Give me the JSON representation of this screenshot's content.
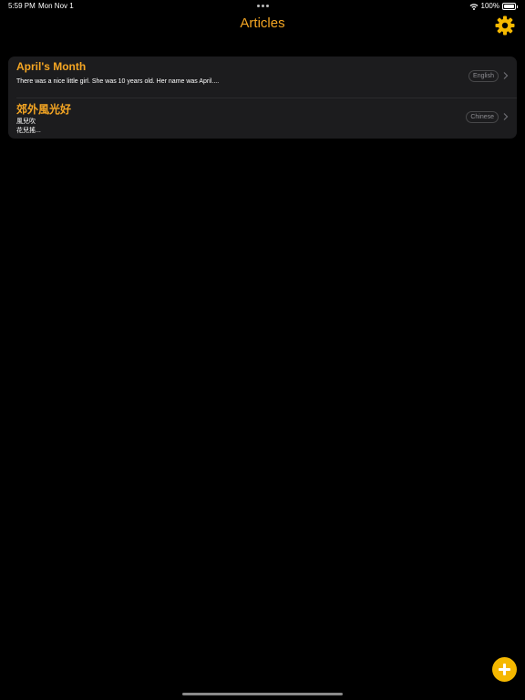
{
  "status_bar": {
    "time": "5:59 PM",
    "date": "Mon Nov 1",
    "battery_percent": "100%",
    "battery_level": 1.0
  },
  "nav": {
    "title": "Articles",
    "settings_icon": "gear-icon"
  },
  "articles": [
    {
      "title": "April's Month",
      "snippet": "There was a nice little girl. She was 10 years old. Her name was April....",
      "language": "English"
    },
    {
      "title": "郊外風光好",
      "snippet": "風兒吹\n花兒搖...",
      "language": "Chinese"
    }
  ],
  "add_button": {
    "icon": "plus-icon"
  },
  "colors": {
    "accent": "#f5a623",
    "fab": "#f5b800",
    "background": "#000000",
    "card": "#1c1c1e"
  }
}
